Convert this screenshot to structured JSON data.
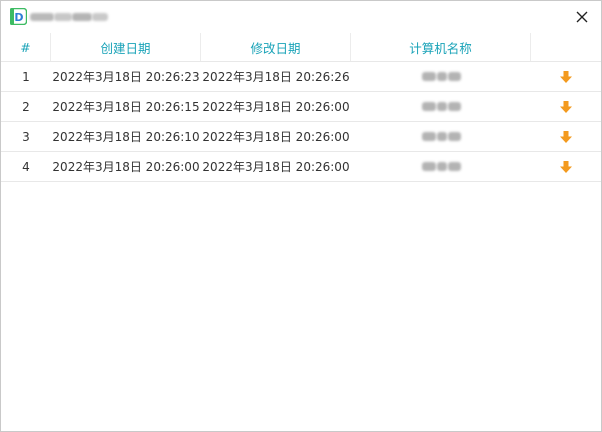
{
  "window": {
    "close_icon": "close-icon",
    "logo_icon": "app-logo-icon",
    "logo_letter": "D"
  },
  "table": {
    "headers": {
      "index": "#",
      "created": "创建日期",
      "modified": "修改日期",
      "computer": "计算机名称"
    },
    "rows": [
      {
        "index": "1",
        "created": "2022年3月18日 20:26:23",
        "modified": "2022年3月18日 20:26:26"
      },
      {
        "index": "2",
        "created": "2022年3月18日 20:26:15",
        "modified": "2022年3月18日 20:26:00"
      },
      {
        "index": "3",
        "created": "2022年3月18日 20:26:10",
        "modified": "2022年3月18日 20:26:00"
      },
      {
        "index": "4",
        "created": "2022年3月18日 20:26:00",
        "modified": "2022年3月18日 20:26:00"
      }
    ],
    "download_icon": "download-arrow-icon"
  },
  "colors": {
    "header_text": "#1aa3b8",
    "download_arrow": "#f39a1e",
    "logo_green": "#3dbb63",
    "logo_blue": "#2f7fd6"
  }
}
